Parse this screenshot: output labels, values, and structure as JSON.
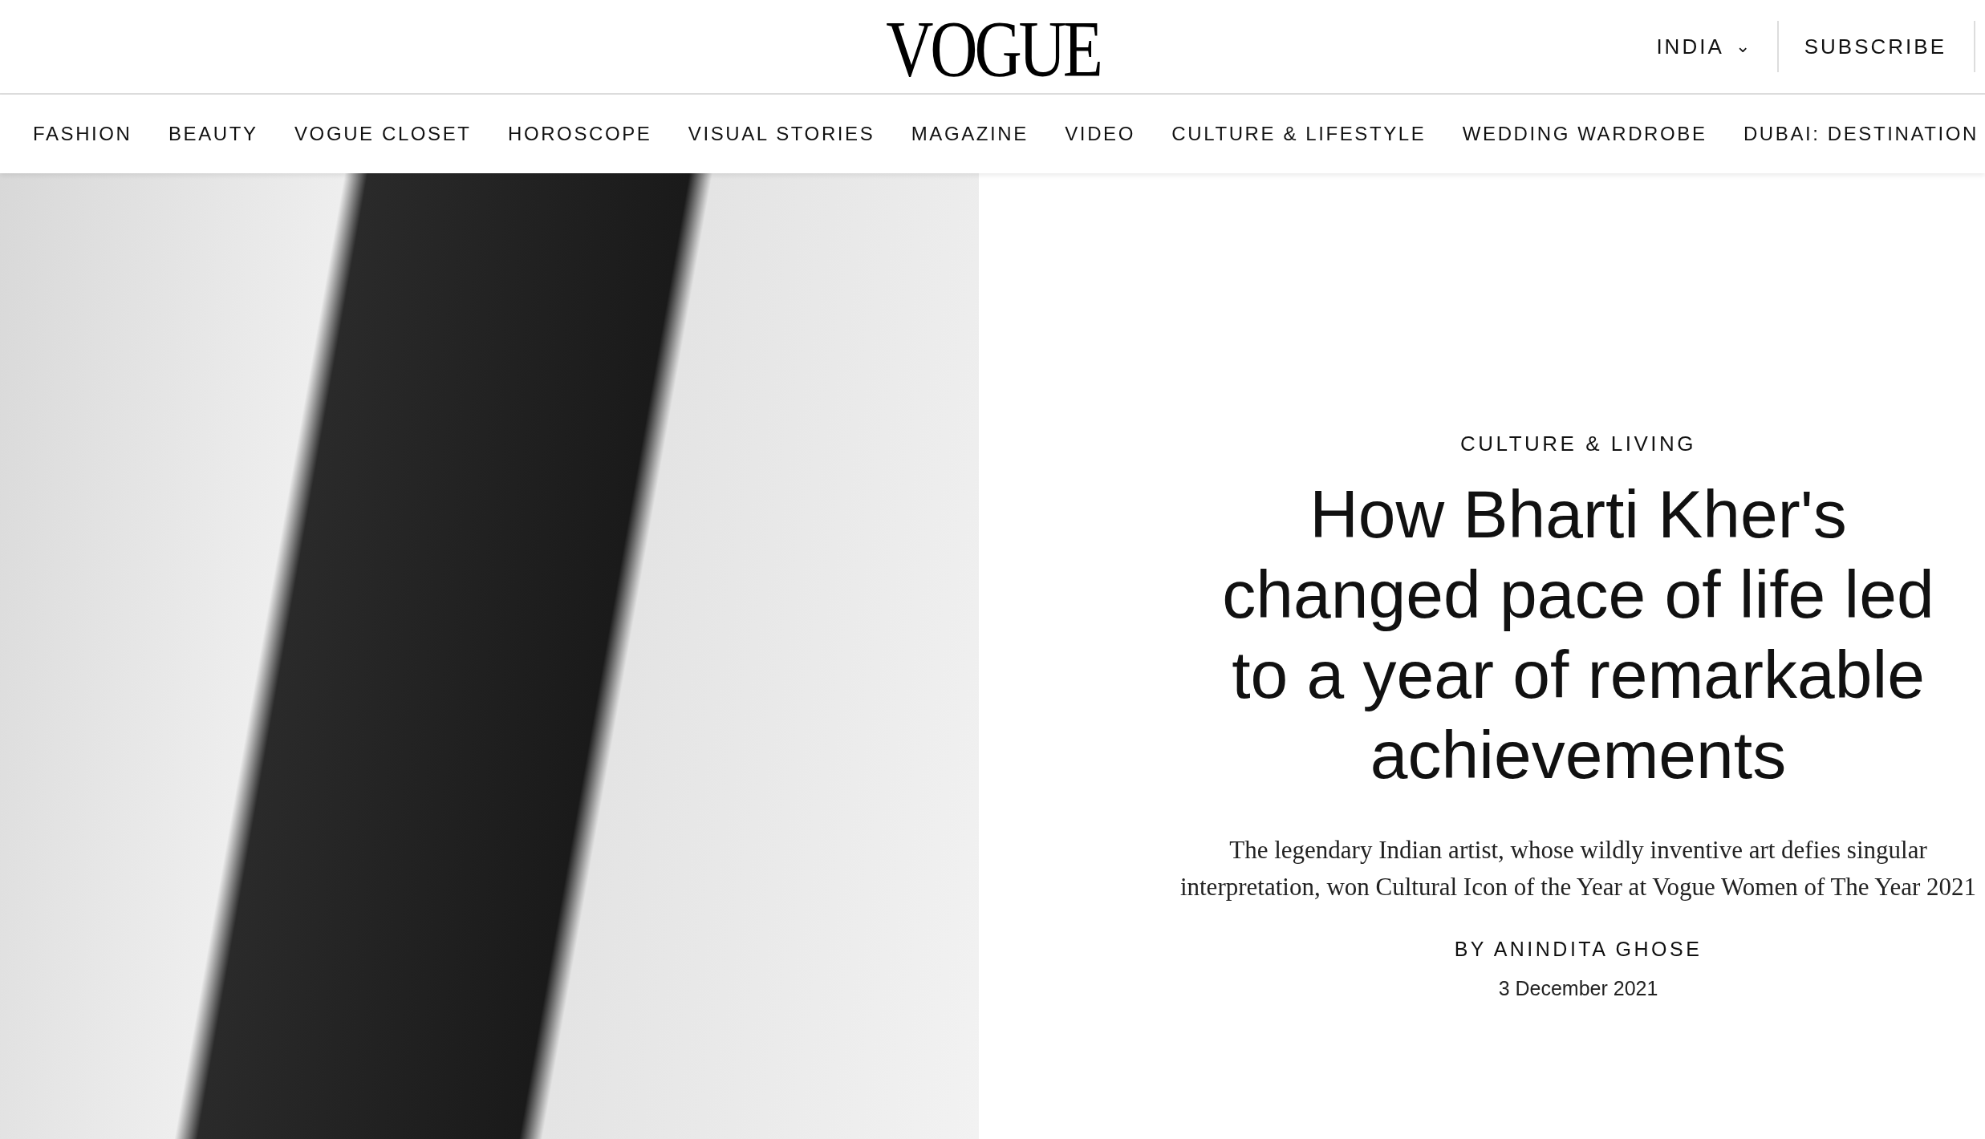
{
  "header": {
    "logo": "VOGUE",
    "region": {
      "label": "INDIA",
      "caret": "⌄"
    },
    "subscribe": "SUBSCRIBE"
  },
  "nav": [
    "FASHION",
    "BEAUTY",
    "VOGUE CLOSET",
    "HOROSCOPE",
    "VISUAL STORIES",
    "MAGAZINE",
    "VIDEO",
    "CULTURE & LIFESTYLE",
    "WEDDING WARDROBE",
    "DUBAI: DESTINATION"
  ],
  "article": {
    "kicker": "CULTURE & LIVING",
    "headline": "How Bharti Kher's changed pace of life led to a year of remarkable achievements",
    "deck": "The legendary Indian artist, whose wildly inventive art defies singular interpretation, won Cultural Icon of the Year at Vogue Women of The Year 2021",
    "byline": "BY ANINDITA GHOSE",
    "date": "3 December 2021"
  }
}
